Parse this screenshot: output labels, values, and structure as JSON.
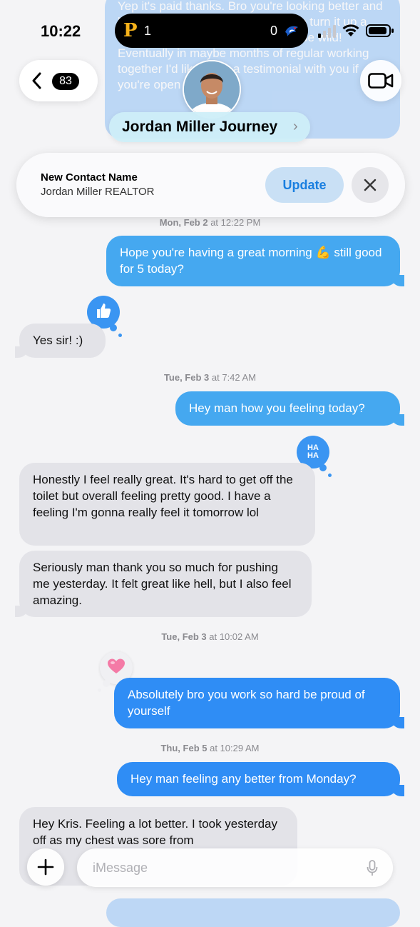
{
  "status_bar": {
    "time": "10:22",
    "score_team_a": "1",
    "score_team_b": "0",
    "team_a_letter": "P"
  },
  "header": {
    "back_badge": "83",
    "contact_name": "Jordan Miller Journey",
    "contact_chevron": "›"
  },
  "background_message": "Yep it's paid thanks. Bro you're looking better and better every time I see you. Start to turn it up a notch and the results are going to be wild! Eventually in maybe months of regular working together I'd like to do a testimonial with you if you're open to it man.",
  "contact_banner": {
    "title": "New Contact Name",
    "subtitle": "Jordan Miller REALTOR",
    "update_label": "Update",
    "close_icon": "×"
  },
  "timestamps": {
    "t0_day": "Mon, Feb 2",
    "t0_time": "at 12:22 PM",
    "t1_day": "Tue, Feb 3",
    "t1_time": "at 7:42 AM",
    "t2_day": "Tue, Feb 3",
    "t2_time": "at 10:02 AM",
    "t3_day": "Thu, Feb 5",
    "t3_time": "at 10:29 AM"
  },
  "messages": {
    "m1": "Hope you're having a great morning 💪 still good for 5 today?",
    "m2": "Yes sir! :)",
    "m3": "Hey man how you feeling today?",
    "m4": "Honestly I feel really great. It's hard to get off the toilet but overall feeling pretty good. I have a feeling I'm gonna really feel it tomorrow lol",
    "m5": "Seriously man thank you so much for pushing me yesterday. It felt great like hell, but I also feel amazing.",
    "m6": "Absolutely bro you work so hard be proud of yourself",
    "m7": "Hey man feeling any better from Monday?",
    "m8": "Hey Kris. Feeling a lot better. I took yesterday off as my chest was sore from"
  },
  "tapbacks": {
    "haha_line1": "HA",
    "haha_line2": "HA"
  },
  "composer": {
    "placeholder": "iMessage",
    "plus": "+"
  },
  "colors": {
    "sent": "#2f8df5",
    "received": "#e3e3e8",
    "accent": "#1a7fe0"
  }
}
